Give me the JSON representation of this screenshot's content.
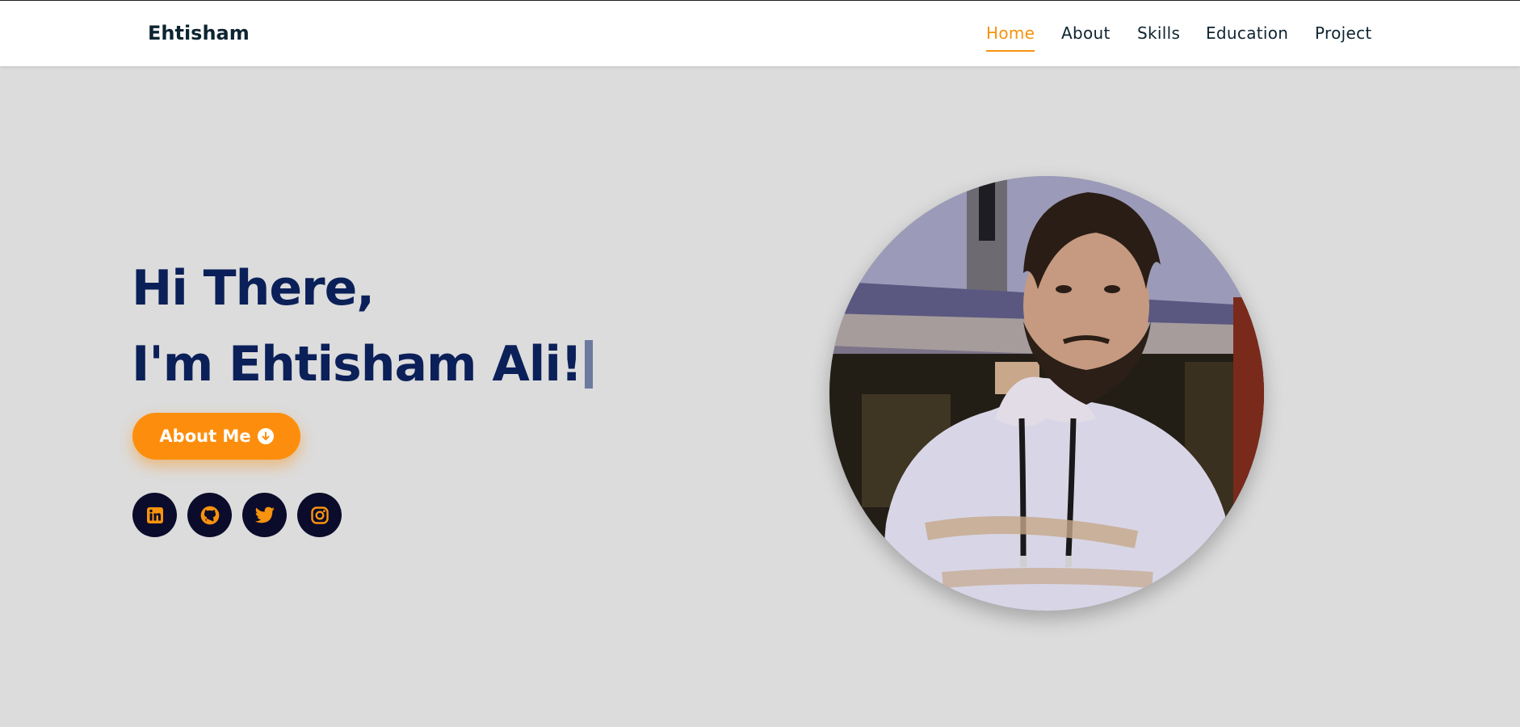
{
  "header": {
    "brand": "Ehtisham",
    "nav": [
      {
        "label": "Home",
        "active": true
      },
      {
        "label": "About",
        "active": false
      },
      {
        "label": "Skills",
        "active": false
      },
      {
        "label": "Education",
        "active": false
      },
      {
        "label": "Project",
        "active": false
      }
    ]
  },
  "hero": {
    "greeting": "Hi There,",
    "intro": "I'm Ehtisham Ali!",
    "button_label": "About Me",
    "socials": [
      {
        "icon": "linkedin-icon"
      },
      {
        "icon": "github-icon"
      },
      {
        "icon": "twitter-icon"
      },
      {
        "icon": "instagram-icon"
      }
    ]
  },
  "colors": {
    "accent": "#f7930e",
    "button": "#fd8e0d",
    "heading": "#0b2059",
    "background": "#dcdcdc",
    "social_bg": "#0b0b2b"
  }
}
